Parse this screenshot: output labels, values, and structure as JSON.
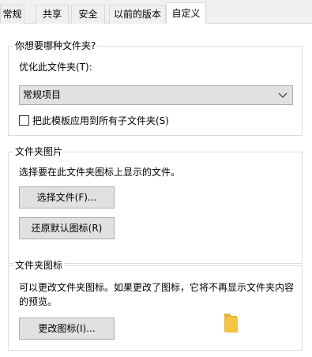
{
  "tabs": [
    {
      "label": "常规"
    },
    {
      "label": "共享"
    },
    {
      "label": "安全"
    },
    {
      "label": "以前的版本"
    },
    {
      "label": "自定义",
      "active": true
    }
  ],
  "optimize_group": {
    "title": "你想要哪种文件夹?",
    "label": "优化此文件夹(T):",
    "select_value": "常规项目",
    "checkbox_label": "把此模板应用到所有子文件夹(S)",
    "checkbox_checked": false
  },
  "picture_group": {
    "title": "文件夹图片",
    "description": "选择要在此文件夹图标上显示的文件。",
    "choose_button": "选择文件(F)...",
    "restore_button": "还原默认图标(R)"
  },
  "icon_group": {
    "title": "文件夹图标",
    "description_line1": "可以更改文件夹图标。如果更改了图标，它将不再显示文件夹内容",
    "description_line2": "的预览。",
    "change_button": "更改图标(I)..."
  },
  "colors": {
    "tab_bg": "#f0f0f0",
    "button_bg": "#e1e1e1",
    "button_border": "#adadad",
    "group_border": "#dcdcdc",
    "folder_yellow": "#f4c542"
  },
  "icons": [
    "chevron-down-icon",
    "folder-icon"
  ]
}
